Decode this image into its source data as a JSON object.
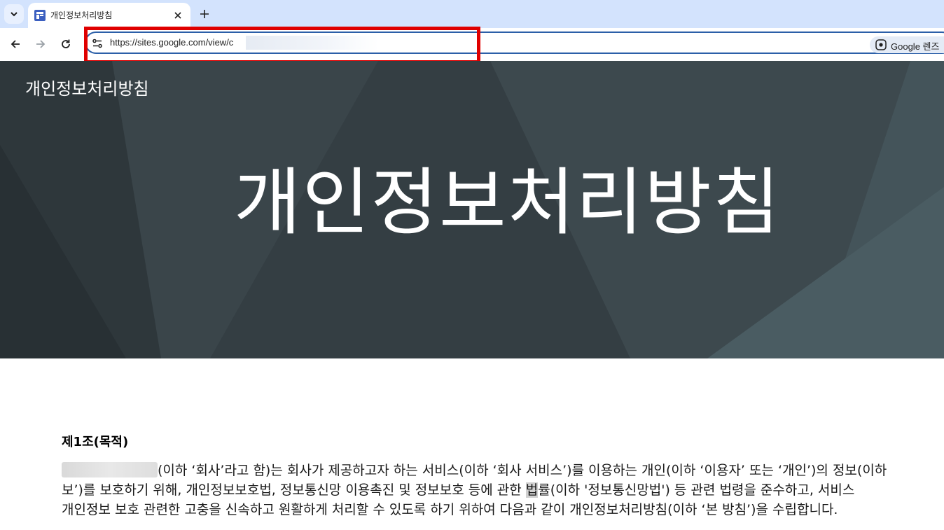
{
  "browser": {
    "tab_title": "개인정보처리방침",
    "url": "https://sites.google.com/view/c",
    "lens_label": "Google 렌즈"
  },
  "site": {
    "name": "개인정보처리방침",
    "hero_title": "개인정보처리방침"
  },
  "article": {
    "heading": "제1조(목적)",
    "line1": "(이하 ‘회사’라고 함)는 회사가 제공하고자 하는 서비스(이하 ‘회사 서비스’)를 이용하는 개인(이하 ‘이용자’ 또는 ‘개인’)의 정보(이하",
    "line2_a": "보’)를 보호하기 위해, 개인정보보호법, 정보통신망 이용촉진 및 정보보호 등에 관한 ",
    "line2_hl": "법",
    "line2_b": "률(이하 '정보통신망법') 등 관련 법령을 준수하고, 서비스",
    "line3": "개인정보 보호 관련한 고충을 신속하고 원활하게 처리할 수 있도록 하기 위하여 다음과 같이 개인정보처리방침(이하 ‘본 방침’)을 수립합니다."
  },
  "colors": {
    "tabstrip": "#d3e3fd",
    "banner": "#333d42",
    "highlight": "#e00000",
    "omnibox_border": "#2b5fa8"
  },
  "icons": [
    "tab-search-icon",
    "site-favicon",
    "close-icon",
    "plus-icon",
    "back-arrow-icon",
    "forward-arrow-icon",
    "reload-icon",
    "site-info-icon",
    "lens-icon"
  ]
}
